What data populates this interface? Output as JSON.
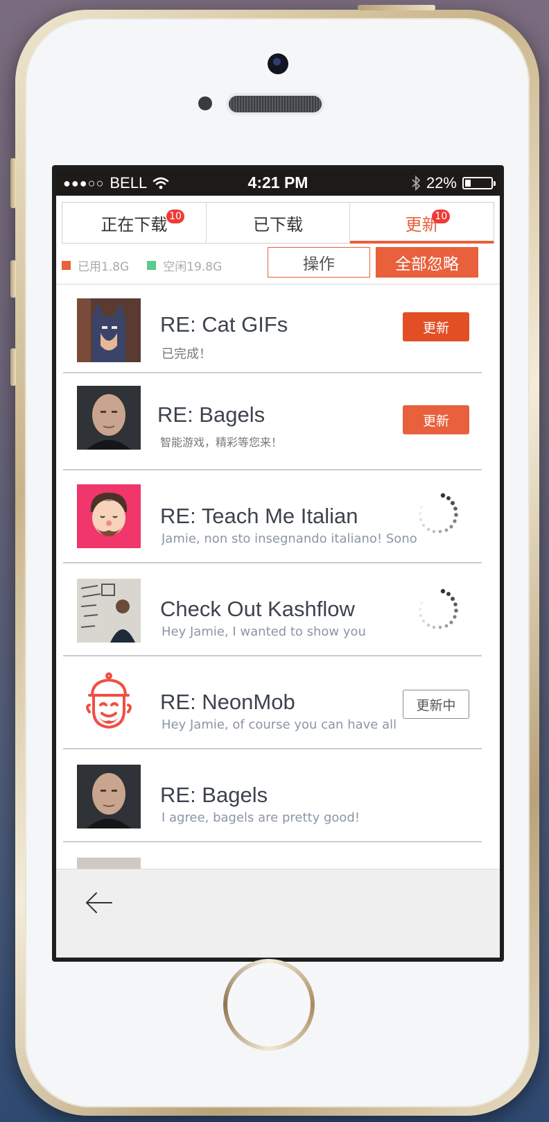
{
  "statusbar": {
    "signal": "●●●○○",
    "carrier": "BELL",
    "time": "4:21 PM",
    "battery": "22%",
    "battery_level": 0.22
  },
  "tabs": [
    {
      "label": "正在下载",
      "badge": "10",
      "active": false
    },
    {
      "label": "已下载",
      "badge": "",
      "active": false
    },
    {
      "label": "更新",
      "badge": "10",
      "active": true
    }
  ],
  "storage": {
    "used": "已用1.8G",
    "free": "空闲19.8G",
    "used_color": "#e8603c",
    "free_color": "#58cc8a"
  },
  "toolbar": {
    "operate_label": "操作",
    "ignore_all_label": "全部忽略"
  },
  "items": [
    {
      "title": "RE: Cat GIFs",
      "subtitle": "已完成！",
      "state": "button",
      "button": "更新"
    },
    {
      "title": "RE: Bagels",
      "subtitle": "智能游戏，精彩等您来！",
      "state": "button",
      "button": "更新"
    },
    {
      "title": "RE: Teach Me Italian",
      "subtitle": "Jamie, non sto insegnando italiano! Sono",
      "state": "loading",
      "button": ""
    },
    {
      "title": "Check Out Kashflow",
      "subtitle": "Hey Jamie, I wanted to show you",
      "state": "loading",
      "button": ""
    },
    {
      "title": "RE: NeonMob",
      "subtitle": "Hey Jamie, of course you can have all",
      "state": "updating",
      "button": "更新中"
    },
    {
      "title": "RE: Bagels",
      "subtitle": "I agree, bagels are pretty good!",
      "state": "none",
      "button": ""
    }
  ],
  "colors": {
    "accent": "#e8603c",
    "badge": "#ee3b37"
  },
  "icons": {
    "back": "back-arrow-icon",
    "wifi": "wifi-icon",
    "bluetooth": "bluetooth-icon",
    "battery": "battery-icon"
  }
}
